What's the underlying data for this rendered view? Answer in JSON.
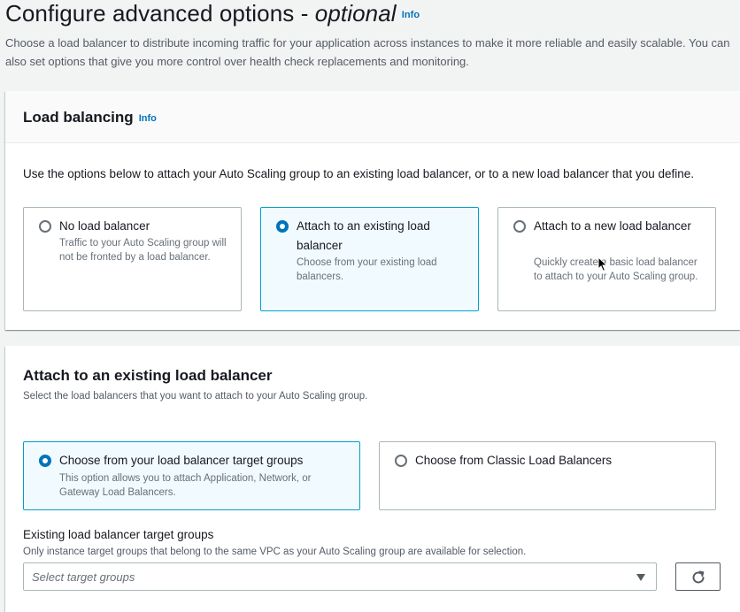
{
  "header": {
    "title_main": "Configure advanced options - ",
    "title_em": "optional",
    "info": "Info",
    "description": "Choose a load balancer to distribute incoming traffic for your application across instances to make it more reliable and easily scalable. You can also set options that give you more control over health check replacements and monitoring."
  },
  "load_balancing": {
    "title": "Load balancing",
    "info": "Info",
    "description": "Use the options below to attach your Auto Scaling group to an existing load balancer, or to a new load balancer that you define.",
    "options": [
      {
        "label": "No load balancer",
        "desc": "Traffic to your Auto Scaling group will not be fronted by a load balancer.",
        "selected": false
      },
      {
        "label": "Attach to an existing load balancer",
        "desc": "Choose from your existing load balancers.",
        "selected": true
      },
      {
        "label": "Attach to a new load balancer",
        "desc": "Quickly create a basic load balancer to attach to your Auto Scaling group.",
        "selected": false
      }
    ]
  },
  "attach_existing": {
    "title": "Attach to an existing load balancer",
    "subtitle": "Select the load balancers that you want to attach to your Auto Scaling group.",
    "options": [
      {
        "label": "Choose from your load balancer target groups",
        "desc": "This option allows you to attach Application, Network, or Gateway Load Balancers.",
        "selected": true
      },
      {
        "label": "Choose from Classic Load Balancers",
        "desc": "",
        "selected": false
      }
    ],
    "target_groups": {
      "label": "Existing load balancer target groups",
      "description": "Only instance target groups that belong to the same VPC as your Auto Scaling group are available for selection.",
      "placeholder": "Select target groups"
    }
  },
  "icons": {
    "refresh": "refresh-icon",
    "dropdown": "caret-down-icon",
    "cursor": "mouse-pointer-icon"
  },
  "colors": {
    "accent": "#0073bb",
    "selected_bg": "#f1faff",
    "selected_border": "#00a1c9"
  }
}
